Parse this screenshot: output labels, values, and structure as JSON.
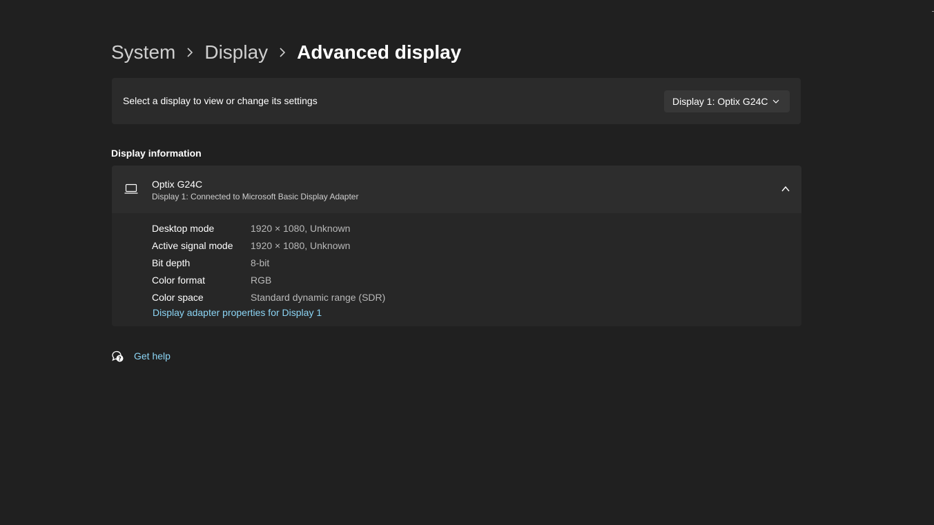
{
  "breadcrumb": {
    "items": [
      "System",
      "Display",
      "Advanced display"
    ]
  },
  "display_select": {
    "label": "Select a display to view or change its settings",
    "selected": "Display 1: Optix G24C"
  },
  "display_information": {
    "title": "Display information",
    "monitor_name": "Optix G24C",
    "connection": "Display 1: Connected to Microsoft Basic Display Adapter",
    "rows": [
      {
        "key": "Desktop mode",
        "value": "1920 × 1080, Unknown"
      },
      {
        "key": "Active signal mode",
        "value": "1920 × 1080, Unknown"
      },
      {
        "key": "Bit depth",
        "value": "8-bit"
      },
      {
        "key": "Color format",
        "value": "RGB"
      },
      {
        "key": "Color space",
        "value": "Standard dynamic range (SDR)"
      }
    ],
    "adapter_link": "Display adapter properties for Display 1"
  },
  "help": {
    "label": "Get help",
    "icon": "help-chat-icon"
  },
  "colors": {
    "background": "#202020",
    "card": "#2b2b2b",
    "link": "#8cd5f5"
  }
}
